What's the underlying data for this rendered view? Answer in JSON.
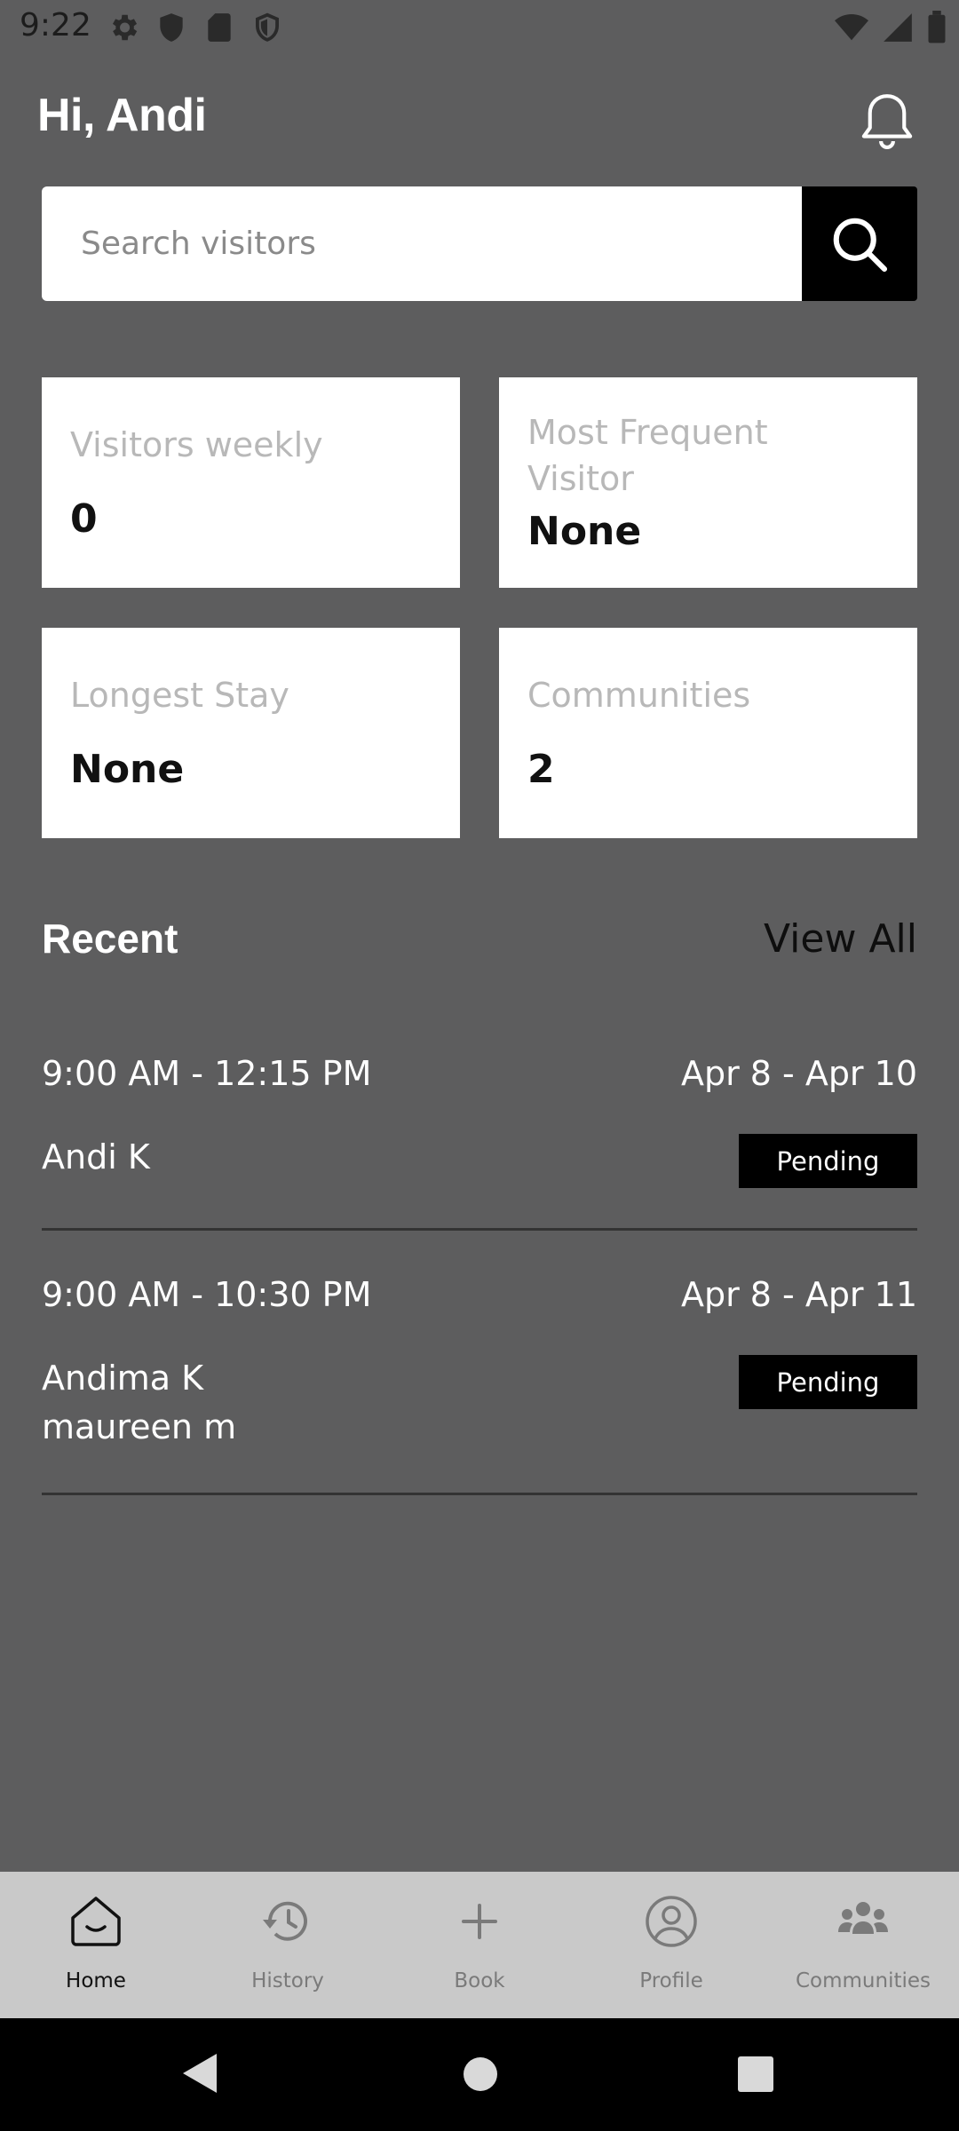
{
  "status_bar": {
    "time": "9:22",
    "left_icons": [
      "gear-icon",
      "shield-icon",
      "sd-card-icon",
      "privacy-shield-icon"
    ],
    "right_icons": [
      "wifi-icon",
      "cellular-signal-icon",
      "battery-icon"
    ]
  },
  "header": {
    "greeting": "Hi, Andi",
    "notification_icon": "bell-icon"
  },
  "search": {
    "placeholder": "Search visitors",
    "button_icon": "search-icon"
  },
  "stats": [
    {
      "label": "Visitors weekly",
      "value": "0"
    },
    {
      "label": "Most Frequent Visitor",
      "value": "None"
    },
    {
      "label": "Longest Stay",
      "value": "None"
    },
    {
      "label": "Communities",
      "value": "2"
    }
  ],
  "recent": {
    "title": "Recent",
    "view_all": "View All",
    "items": [
      {
        "time": "9:00 AM - 12:15 PM",
        "dates": "Apr 8 - Apr 10",
        "visitors": [
          "Andi K"
        ],
        "status": "Pending"
      },
      {
        "time": "9:00 AM - 10:30 PM",
        "dates": "Apr 8 - Apr 11",
        "visitors": [
          "Andima K",
          "maureen m"
        ],
        "status": "Pending"
      }
    ]
  },
  "bottom_nav": {
    "items": [
      {
        "label": "Home",
        "icon": "home-icon",
        "active": true
      },
      {
        "label": "History",
        "icon": "history-icon",
        "active": false
      },
      {
        "label": "Book",
        "icon": "plus-icon",
        "active": false
      },
      {
        "label": "Profile",
        "icon": "profile-icon",
        "active": false
      },
      {
        "label": "Communities",
        "icon": "group-icon",
        "active": false
      }
    ]
  },
  "system_nav": {
    "buttons": [
      "back-icon",
      "home-circle-icon",
      "recents-icon"
    ]
  },
  "colors": {
    "background": "#5d5d5e",
    "card": "#ffffff",
    "badge": "#000000",
    "nav_bar": "#c9c9c9"
  }
}
